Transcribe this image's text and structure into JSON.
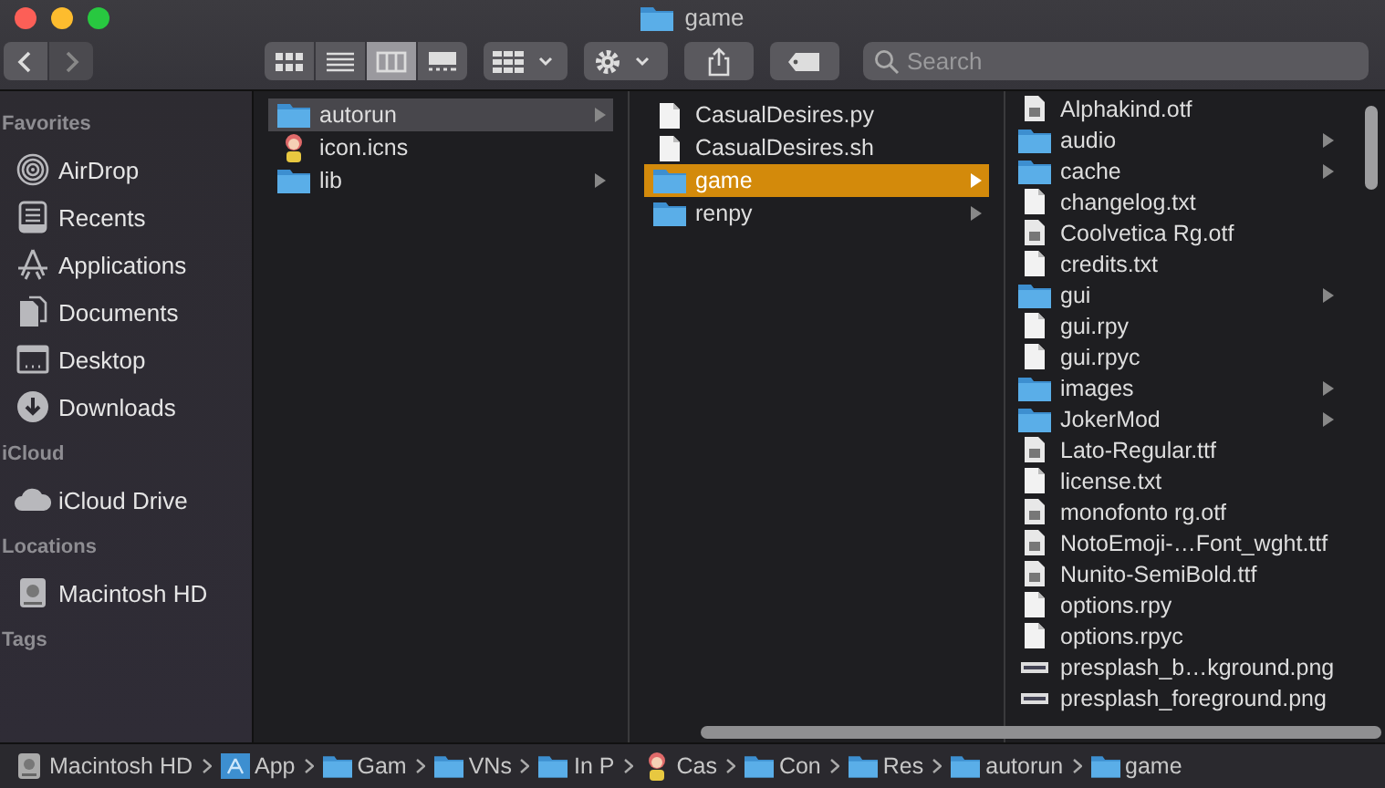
{
  "window": {
    "title": "game"
  },
  "toolbar": {
    "view_buttons": [
      {
        "kind": "icons",
        "selected": false
      },
      {
        "kind": "list",
        "selected": false
      },
      {
        "kind": "columns",
        "selected": true
      },
      {
        "kind": "gallery",
        "selected": false
      }
    ],
    "search": {
      "placeholder": "Search"
    }
  },
  "sidebar": {
    "sections": [
      {
        "title": "Favorites",
        "items": [
          {
            "label": "AirDrop",
            "kind": "airdrop"
          },
          {
            "label": "Recents",
            "kind": "recents"
          },
          {
            "label": "Applications",
            "kind": "apps"
          },
          {
            "label": "Documents",
            "kind": "docs"
          },
          {
            "label": "Desktop",
            "kind": "desktop"
          },
          {
            "label": "Downloads",
            "kind": "downloads"
          }
        ]
      },
      {
        "title": "iCloud",
        "items": [
          {
            "label": "iCloud Drive",
            "kind": "cloud"
          }
        ]
      },
      {
        "title": "Locations",
        "items": [
          {
            "label": "Macintosh HD",
            "kind": "disk"
          }
        ]
      },
      {
        "title": "Tags"
      }
    ]
  },
  "columns": [
    {
      "items": [
        {
          "name": "autorun",
          "kind": "folder",
          "expandable": true,
          "selected": true
        },
        {
          "name": "icon.icns",
          "kind": "app",
          "expandable": false,
          "selected": false
        },
        {
          "name": "lib",
          "kind": "folder",
          "expandable": true,
          "selected": false
        }
      ]
    },
    {
      "items": [
        {
          "name": "CasualDesires.py",
          "kind": "doc",
          "expandable": false,
          "selected": false
        },
        {
          "name": "CasualDesires.sh",
          "kind": "doc",
          "expandable": false,
          "selected": false
        },
        {
          "name": "game",
          "kind": "folder",
          "expandable": true,
          "selected": true
        },
        {
          "name": "renpy",
          "kind": "folder",
          "expandable": true,
          "selected": false
        }
      ]
    },
    {
      "items": [
        {
          "name": "Alphakind.otf",
          "kind": "font",
          "expandable": false,
          "selected": false
        },
        {
          "name": "audio",
          "kind": "folder",
          "expandable": true,
          "selected": false
        },
        {
          "name": "cache",
          "kind": "folder",
          "expandable": true,
          "selected": false
        },
        {
          "name": "changelog.txt",
          "kind": "doc",
          "expandable": false,
          "selected": false
        },
        {
          "name": "Coolvetica Rg.otf",
          "kind": "font",
          "expandable": false,
          "selected": false
        },
        {
          "name": "credits.txt",
          "kind": "doc",
          "expandable": false,
          "selected": false
        },
        {
          "name": "gui",
          "kind": "folder",
          "expandable": true,
          "selected": false
        },
        {
          "name": "gui.rpy",
          "kind": "doc",
          "expandable": false,
          "selected": false
        },
        {
          "name": "gui.rpyc",
          "kind": "doc",
          "expandable": false,
          "selected": false
        },
        {
          "name": "images",
          "kind": "folder",
          "expandable": true,
          "selected": false
        },
        {
          "name": "JokerMod",
          "kind": "folder",
          "expandable": true,
          "selected": false
        },
        {
          "name": "Lato-Regular.ttf",
          "kind": "font",
          "expandable": false,
          "selected": false
        },
        {
          "name": "license.txt",
          "kind": "doc",
          "expandable": false,
          "selected": false
        },
        {
          "name": "monofonto rg.otf",
          "kind": "font",
          "expandable": false,
          "selected": false
        },
        {
          "name": "NotoEmoji-…Font_wght.ttf",
          "kind": "font",
          "expandable": false,
          "selected": false
        },
        {
          "name": "Nunito-SemiBold.ttf",
          "kind": "font",
          "expandable": false,
          "selected": false
        },
        {
          "name": "options.rpy",
          "kind": "doc",
          "expandable": false,
          "selected": false
        },
        {
          "name": "options.rpyc",
          "kind": "doc",
          "expandable": false,
          "selected": false
        },
        {
          "name": "presplash_b…kground.png",
          "kind": "image",
          "expandable": false,
          "selected": false
        },
        {
          "name": "presplash_foreground.png",
          "kind": "image",
          "expandable": false,
          "selected": false
        }
      ]
    }
  ],
  "path_bar": [
    {
      "label": "Macintosh HD",
      "kind": "disk"
    },
    {
      "label": "App",
      "kind": "apps"
    },
    {
      "label": "Gam",
      "kind": "folder"
    },
    {
      "label": "VNs",
      "kind": "folder"
    },
    {
      "label": "In P",
      "kind": "folder"
    },
    {
      "label": "Cas",
      "kind": "app"
    },
    {
      "label": "Con",
      "kind": "folder"
    },
    {
      "label": "Res",
      "kind": "folder"
    },
    {
      "label": "autorun",
      "kind": "folder"
    },
    {
      "label": "game",
      "kind": "folder"
    }
  ]
}
